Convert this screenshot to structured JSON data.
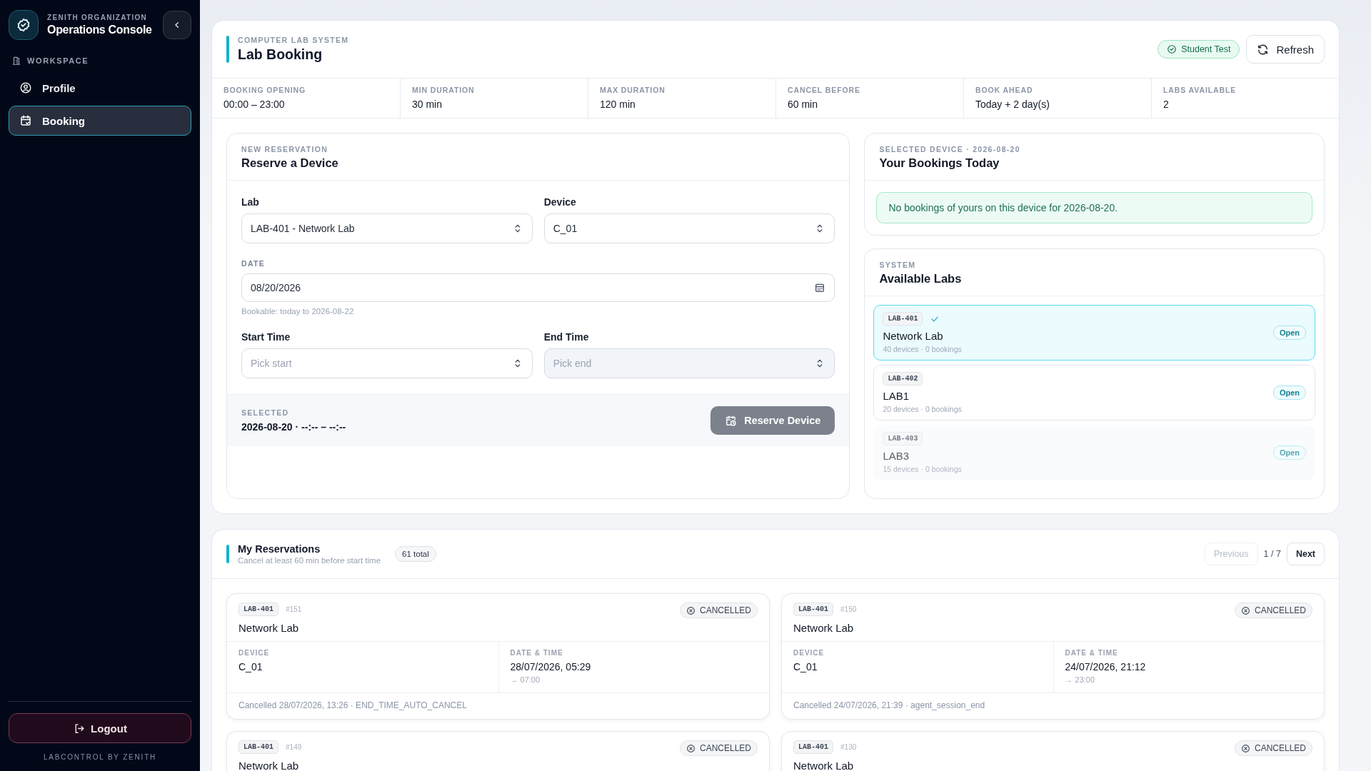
{
  "sidebar": {
    "org": "ZENITH ORGANIZATION",
    "title": "Operations Console",
    "section": "WORKSPACE",
    "items": [
      {
        "label": "Profile",
        "selected": false
      },
      {
        "label": "Booking",
        "selected": true
      }
    ],
    "logout": "Logout",
    "footer": "LABCONTROL BY ZENITH"
  },
  "header": {
    "eyebrow": "COMPUTER LAB SYSTEM",
    "title": "Lab Booking",
    "role_badge": "Student Test",
    "refresh": "Refresh"
  },
  "stats": [
    {
      "label": "BOOKING OPENING",
      "value": "00:00 – 23:00"
    },
    {
      "label": "MIN DURATION",
      "value": "30 min"
    },
    {
      "label": "MAX DURATION",
      "value": "120 min"
    },
    {
      "label": "CANCEL BEFORE",
      "value": "60 min"
    },
    {
      "label": "BOOK AHEAD",
      "value": "Today + 2 day(s)"
    },
    {
      "label": "LABS AVAILABLE",
      "value": "2"
    }
  ],
  "reservation_form": {
    "eyebrow": "NEW RESERVATION",
    "title": "Reserve a Device",
    "fields": [
      {
        "kind": "select",
        "label": "Lab",
        "value": "LAB-401 - Network Lab",
        "disabled": false
      },
      {
        "kind": "select",
        "label": "Device",
        "value": "C_01",
        "disabled": false
      },
      {
        "kind": "date",
        "label": "DATE",
        "value": "08/20/2026",
        "hint": "Bookable: today to 2026-08-22",
        "disabled": false
      },
      {
        "kind": "select",
        "label": "Start Time",
        "placeholder": "Pick start",
        "disabled": false
      },
      {
        "kind": "select",
        "label": "End Time",
        "placeholder": "Pick end",
        "disabled": true
      }
    ],
    "selected_label": "SELECTED",
    "selected_value": "2026-08-20 · --:-- – --:--",
    "submit": {
      "label": "Reserve Device",
      "disabled": true
    }
  },
  "bookings_today": {
    "eyebrow": "SELECTED DEVICE · 2026-08-20",
    "title": "Your Bookings Today",
    "message": "No bookings of yours on this device for 2026-08-20."
  },
  "labs": {
    "eyebrow": "SYSTEM",
    "title": "Available Labs",
    "items": [
      {
        "code": "LAB-401",
        "name": "Network Lab",
        "meta": "40 devices · 0 bookings",
        "status": "Open",
        "selected": true,
        "disabled": false
      },
      {
        "code": "LAB-402",
        "name": "LAB1",
        "meta": "20 devices · 0 bookings",
        "status": "Open",
        "selected": false,
        "disabled": false
      },
      {
        "code": "LAB-403",
        "name": "LAB3",
        "meta": "15 devices · 0 bookings",
        "status": "Open",
        "selected": false,
        "disabled": true
      }
    ]
  },
  "reservations": {
    "title": "My Reservations",
    "subtitle": "Cancel at least 60 min before start time",
    "total": "61 total",
    "previous": {
      "label": "Previous",
      "disabled": true
    },
    "page": "1 / 7",
    "next": "Next",
    "items": [
      {
        "code": "LAB-401",
        "number": "#151",
        "status": "CANCELLED",
        "name": "Network Lab",
        "device_label": "DEVICE",
        "device": "C_01",
        "datetime_label": "DATE & TIME",
        "datetime": "28/07/2026, 05:29",
        "end": "→ 07:00",
        "note": "Cancelled 28/07/2026, 13:26 · END_TIME_AUTO_CANCEL"
      },
      {
        "code": "LAB-401",
        "number": "#150",
        "status": "CANCELLED",
        "name": "Network Lab",
        "device_label": "DEVICE",
        "device": "C_01",
        "datetime_label": "DATE & TIME",
        "datetime": "24/07/2026, 21:12",
        "end": "→ 23:00",
        "note": "Cancelled 24/07/2026, 21:39 · agent_session_end"
      },
      {
        "code": "LAB-401",
        "number": "#149",
        "status": "CANCELLED",
        "name": "Network Lab"
      },
      {
        "code": "LAB-401",
        "number": "#130",
        "status": "CANCELLED",
        "name": "Network Lab"
      }
    ]
  }
}
